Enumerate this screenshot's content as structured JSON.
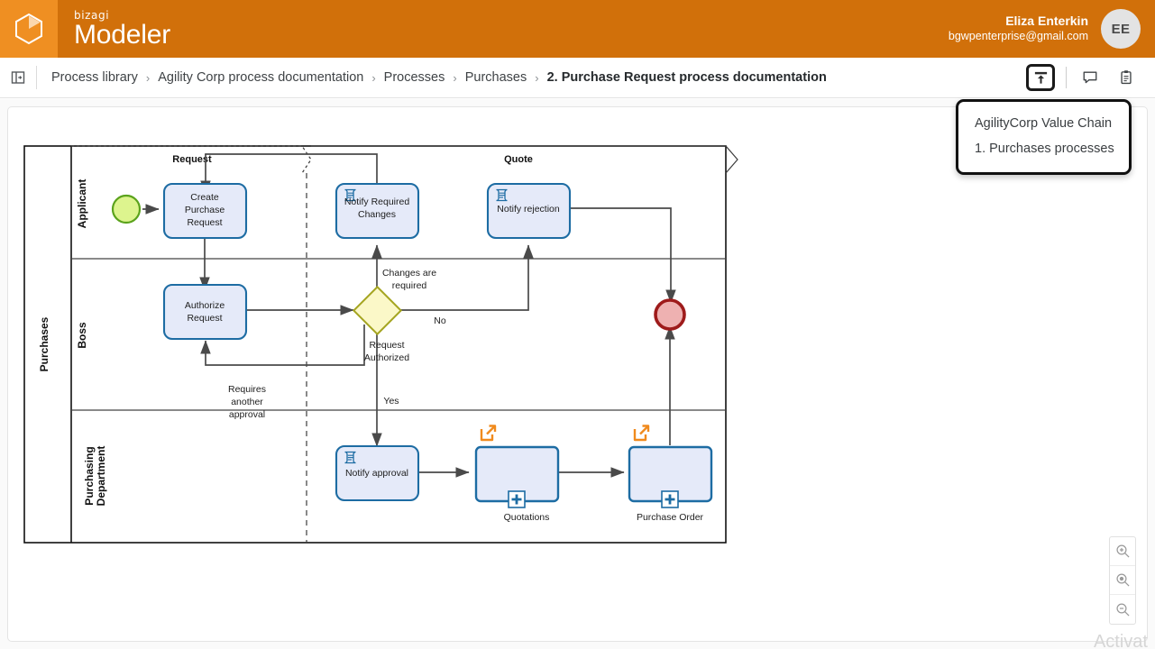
{
  "header": {
    "logo_icon": "hexagon-cube-logo",
    "brand_small": "bizagi",
    "brand_big": "Modeler",
    "user_name": "Eliza Enterkin",
    "user_email": "bgwpenterprise@gmail.com",
    "avatar_initials": "EE",
    "bg_color": "#d1700a",
    "logo_bg_color": "#ef8f22"
  },
  "breadcrumb": {
    "panel_toggle_icon": "panel-toggle-icon",
    "separator": "›",
    "items": [
      {
        "label": "Process library",
        "current": false
      },
      {
        "label": "Agility Corp process documentation",
        "current": false
      },
      {
        "label": "Processes",
        "current": false
      },
      {
        "label": "Purchases",
        "current": false
      },
      {
        "label": "2. Purchase Request process documentation",
        "current": true
      }
    ],
    "actions": [
      {
        "name": "publish-icon",
        "title": "Publish"
      },
      {
        "name": "comment-icon",
        "title": "Comments"
      },
      {
        "name": "clipboard-icon",
        "title": "Tasks"
      }
    ]
  },
  "dropdown": {
    "visible": true,
    "items": [
      {
        "label": "AgilityCorp Value Chain"
      },
      {
        "label": "1. Purchases processes"
      }
    ]
  },
  "zoom_controls": [
    {
      "name": "zoom-in-button",
      "icon": "magnifier-plus"
    },
    {
      "name": "zoom-reset-button",
      "icon": "magnifier-dot"
    },
    {
      "name": "zoom-out-button",
      "icon": "magnifier-minus"
    }
  ],
  "watermark": {
    "text": "Activat"
  },
  "diagram": {
    "pool": {
      "label": "Purchases"
    },
    "lanes": [
      {
        "label": "Applicant"
      },
      {
        "label": "Boss"
      },
      {
        "label": "Purchasing Department"
      }
    ],
    "phases": [
      {
        "label": "Request"
      },
      {
        "label": "Quote"
      }
    ],
    "events": [
      {
        "name": "start-event",
        "type": "start",
        "fill": "#ddf48e",
        "stroke": "#5ba31c"
      },
      {
        "name": "end-event",
        "type": "end",
        "fill": "#eeb1b1",
        "stroke": "#9e1b1b"
      }
    ],
    "tasks": [
      {
        "name": "create-purchase-request",
        "label": "Create\nPurchase\nRequest",
        "type": "user"
      },
      {
        "name": "authorize-request",
        "label": "Authorize\nRequest",
        "type": "user"
      },
      {
        "name": "notify-required-changes",
        "label": "Notify Required\nChanges",
        "type": "script"
      },
      {
        "name": "notify-rejection",
        "label": "Notify rejection",
        "type": "script"
      },
      {
        "name": "notify-approval",
        "label": "Notify approval",
        "type": "script"
      }
    ],
    "subprocesses": [
      {
        "name": "quotations-subprocess",
        "label": "Quotations",
        "link_icon": "external-link-icon"
      },
      {
        "name": "purchase-order-subprocess",
        "label": "Purchase Order",
        "link_icon": "external-link-icon"
      }
    ],
    "gateways": [
      {
        "name": "request-authorized-gateway",
        "label": "Request\nAuthorized",
        "type": "exclusive",
        "fill": "#fbf8c8",
        "stroke": "#a5a521"
      }
    ],
    "flow_labels": [
      {
        "text": "Changes are\nrequired"
      },
      {
        "text": "No"
      },
      {
        "text": "Yes"
      },
      {
        "text": "Requires\nanother\napproval"
      }
    ],
    "colors": {
      "task_fill": "#e5eaf9",
      "task_stroke": "#1d6ca3",
      "flow_stroke": "#4a4a4a",
      "subprocess_link": "#f08a1d"
    }
  }
}
